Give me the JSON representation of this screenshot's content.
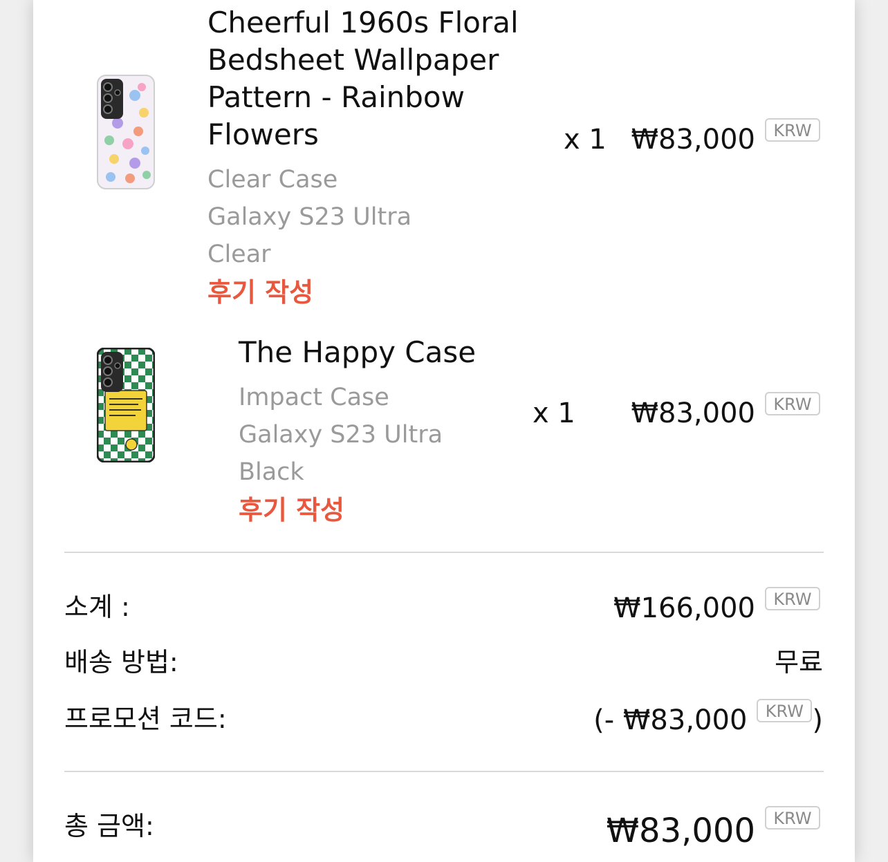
{
  "items": [
    {
      "title_lines": [
        "Cheerful 1960s Floral",
        "Bedsheet Wallpaper",
        "Pattern - Rainbow",
        "Flowers"
      ],
      "type": "Clear Case",
      "device": "Galaxy S23 Ultra",
      "color": "Clear",
      "review_label": "후기 작성",
      "qty": "x 1",
      "price": "₩83,000",
      "currency": "KRW"
    },
    {
      "title": "The Happy Case",
      "type": "Impact Case",
      "device": "Galaxy S23 Ultra",
      "color": "Black",
      "review_label": "후기 작성",
      "qty": "x 1",
      "price": "₩83,000",
      "currency": "KRW"
    }
  ],
  "summary": {
    "subtotal_label": "소계 :",
    "subtotal_value": "₩166,000",
    "subtotal_currency": "KRW",
    "shipping_label": "배송 방법:",
    "shipping_value": "무료",
    "promo_label": "프로모션 코드:",
    "promo_prefix": "(- ",
    "promo_value": "₩83,000",
    "promo_currency": "KRW",
    "promo_suffix": ")",
    "total_label": "총 금액:",
    "total_value": "₩83,000",
    "total_currency": "KRW"
  }
}
